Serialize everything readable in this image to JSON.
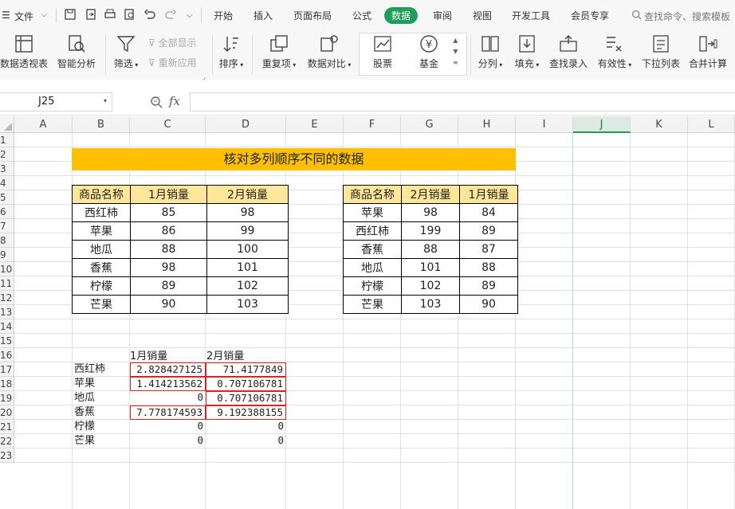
{
  "menu": {
    "file": "文件",
    "tabs": [
      "开始",
      "插入",
      "页面布局",
      "公式",
      "数据",
      "审阅",
      "视图",
      "开发工具",
      "会员专享"
    ],
    "active_tab": "数据",
    "search": "查找命令、搜索模板"
  },
  "ribbon": {
    "pivot": "数据透视表",
    "smart": "智能分析",
    "filter": "筛选",
    "show_all": "全部显示",
    "reapply": "重新应用",
    "sort": "排序",
    "dup": "重复项",
    "compare": "数据对比",
    "stock": "股票",
    "fund": "基金",
    "split": "分列",
    "fill": "填充",
    "lookup": "查找录入",
    "validity": "有效性",
    "dropdown": "下拉列表",
    "merge": "合并计算"
  },
  "formula_bar": {
    "cell_ref": "J25",
    "fx": "fx",
    "content": ""
  },
  "columns": [
    "A",
    "B",
    "C",
    "D",
    "E",
    "F",
    "G",
    "H",
    "I",
    "J",
    "K",
    "L"
  ],
  "selected_column": "J",
  "rows": [
    "1",
    "2",
    "3",
    "4",
    "5",
    "6",
    "7",
    "8",
    "9",
    "10",
    "11",
    "12",
    "13",
    "14",
    "15",
    "16",
    "17",
    "18",
    "19",
    "20",
    "21",
    "22",
    "23"
  ],
  "title": "核对多列顺序不同的数据",
  "table1": {
    "headers": [
      "商品名称",
      "1月销量",
      "2月销量"
    ],
    "rows": [
      [
        "西红柿",
        "85",
        "98"
      ],
      [
        "苹果",
        "86",
        "99"
      ],
      [
        "地瓜",
        "88",
        "100"
      ],
      [
        "香蕉",
        "98",
        "101"
      ],
      [
        "柠檬",
        "89",
        "102"
      ],
      [
        "芒果",
        "90",
        "103"
      ]
    ]
  },
  "table2": {
    "headers": [
      "商品名称",
      "2月销量",
      "1月销量"
    ],
    "rows": [
      [
        "苹果",
        "98",
        "84"
      ],
      [
        "西红柿",
        "199",
        "89"
      ],
      [
        "香蕉",
        "88",
        "87"
      ],
      [
        "地瓜",
        "101",
        "88"
      ],
      [
        "柠檬",
        "102",
        "89"
      ],
      [
        "芒果",
        "103",
        "90"
      ]
    ]
  },
  "result": {
    "headers": [
      "1月销量",
      "2月销量"
    ],
    "rows": [
      [
        "西红柿",
        "2.828427125",
        "71.4177849"
      ],
      [
        "苹果",
        "1.414213562",
        "0.707106781"
      ],
      [
        "地瓜",
        "0",
        "0.707106781"
      ],
      [
        "香蕉",
        "7.778174593",
        "9.192388155"
      ],
      [
        "柠檬",
        "0",
        "0"
      ],
      [
        "芒果",
        "0",
        "0"
      ]
    ]
  },
  "colors": {
    "accent": "#1d9e5a",
    "title_fill": "#ffc000",
    "header_fill": "#ffe699",
    "highlight_border": "#e02020"
  }
}
